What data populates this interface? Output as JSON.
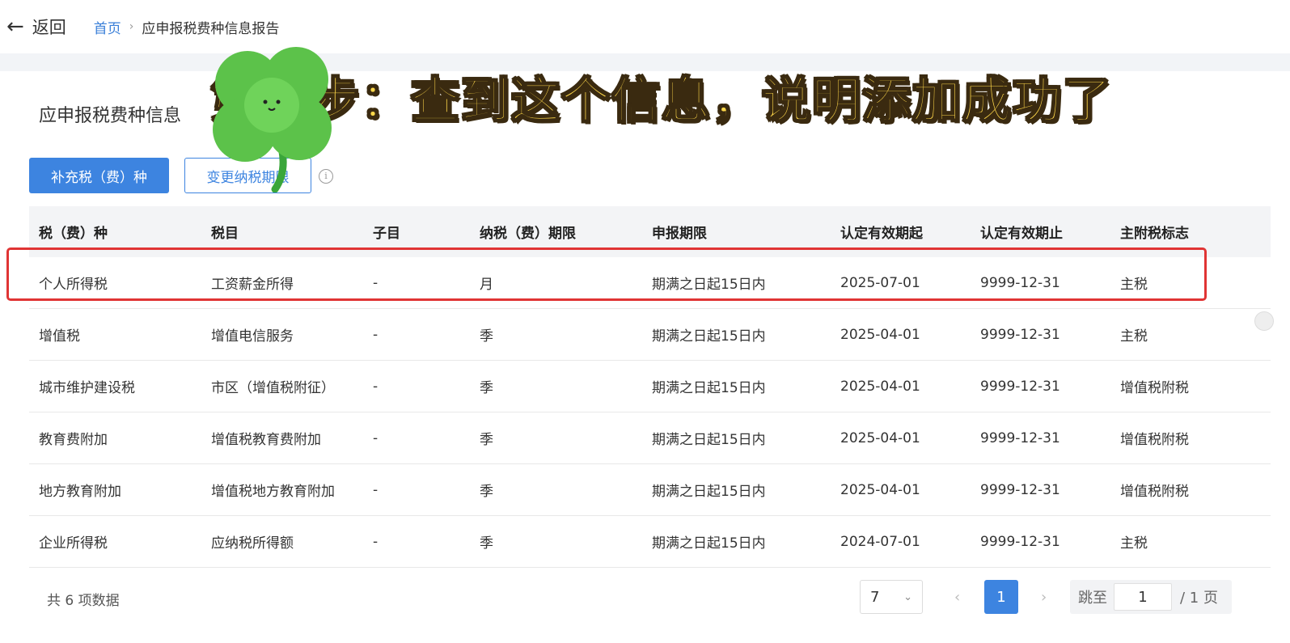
{
  "topbar": {
    "back_label": "返回",
    "breadcrumb_home": "首页",
    "breadcrumb_sep": "›",
    "breadcrumb_current": "应申报税费种信息报告"
  },
  "section": {
    "title": "应申报税费种信息",
    "btn_add": "补充税（费）种",
    "btn_change": "变更纳税期限"
  },
  "table": {
    "headers": [
      "税（费）种",
      "税目",
      "子目",
      "纳税（费）期限",
      "申报期限",
      "认定有效期起",
      "认定有效期止",
      "主附税标志"
    ],
    "rows": [
      [
        "个人所得税",
        "工资薪金所得",
        "-",
        "月",
        "期满之日起15日内",
        "2025-07-01",
        "9999-12-31",
        "主税"
      ],
      [
        "增值税",
        "增值电信服务",
        "-",
        "季",
        "期满之日起15日内",
        "2025-04-01",
        "9999-12-31",
        "主税"
      ],
      [
        "城市维护建设税",
        "市区（增值税附征）",
        "-",
        "季",
        "期满之日起15日内",
        "2025-04-01",
        "9999-12-31",
        "增值税附税"
      ],
      [
        "教育费附加",
        "增值税教育费附加",
        "-",
        "季",
        "期满之日起15日内",
        "2025-04-01",
        "9999-12-31",
        "增值税附税"
      ],
      [
        "地方教育附加",
        "增值税地方教育附加",
        "-",
        "季",
        "期满之日起15日内",
        "2025-04-01",
        "9999-12-31",
        "增值税附税"
      ],
      [
        "企业所得税",
        "应纳税所得额",
        "-",
        "季",
        "期满之日起15日内",
        "2024-07-01",
        "9999-12-31",
        "主税"
      ]
    ]
  },
  "pagination": {
    "total_text": "共 6 项数据",
    "page_size": "7",
    "current_page": "1",
    "jump_label": "跳至",
    "jump_value": "1",
    "total_pages": "/ 1 页"
  },
  "overlay": {
    "caption": "第三步：查到这个信息，说明添加成功了"
  },
  "colors": {
    "primary": "#3d84e0",
    "highlight": "#e03434",
    "caption": "#ffd84a"
  }
}
